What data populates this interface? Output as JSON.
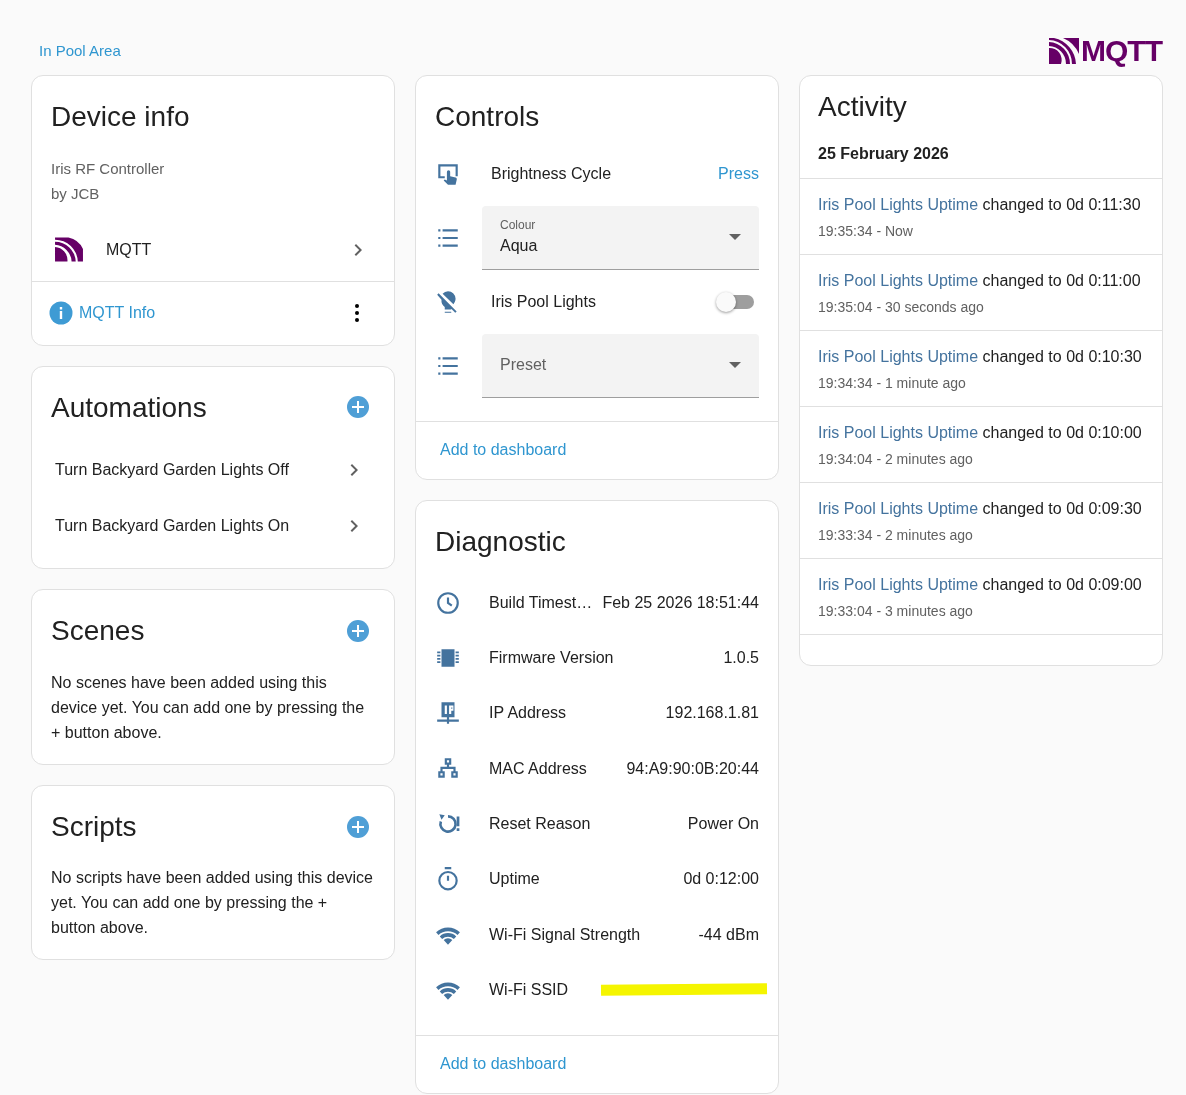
{
  "header": {
    "area_link": "In Pool Area",
    "logo_text": "MQTT"
  },
  "device_info": {
    "title": "Device info",
    "model": "Iris RF Controller",
    "manufacturer": "by JCB",
    "integration": "MQTT",
    "info_link": "MQTT Info"
  },
  "automations": {
    "title": "Automations",
    "items": [
      {
        "label": "Turn Backyard Garden Lights Off"
      },
      {
        "label": "Turn Backyard Garden Lights On"
      }
    ]
  },
  "scenes": {
    "title": "Scenes",
    "empty_text": "No scenes have been added using this device yet. You can add one by pressing the + button above."
  },
  "scripts": {
    "title": "Scripts",
    "empty_text": "No scripts have been added using this device yet. You can add one by pressing the + button above."
  },
  "controls": {
    "title": "Controls",
    "items": [
      {
        "kind": "button",
        "label": "Brightness Cycle",
        "action": "Press"
      },
      {
        "kind": "select",
        "label": "Colour",
        "value": "Aqua"
      },
      {
        "kind": "switch",
        "label": "Iris Pool Lights",
        "on": false
      },
      {
        "kind": "select",
        "label": "Preset"
      }
    ],
    "footer_link": "Add to dashboard"
  },
  "diagnostic": {
    "title": "Diagnostic",
    "items": [
      {
        "label": "Build Timest…",
        "value": "Feb 25 2026 18:51:44"
      },
      {
        "label": "Firmware Version",
        "value": "1.0.5"
      },
      {
        "label": "IP Address",
        "value": "192.168.1.81"
      },
      {
        "label": "MAC Address",
        "value": "94:A9:90:0B:20:44"
      },
      {
        "label": "Reset Reason",
        "value": "Power On"
      },
      {
        "label": "Uptime",
        "value": "0d 0:12:00"
      },
      {
        "label": "Wi-Fi Signal Strength",
        "value": "-44 dBm"
      },
      {
        "label": "Wi-Fi SSID",
        "redacted": true
      }
    ],
    "footer_link": "Add to dashboard"
  },
  "activity": {
    "title": "Activity",
    "date": "25 February 2026",
    "entries": [
      {
        "entity": "Iris Pool Lights Uptime",
        "message": "changed to 0d 0:11:30",
        "time": "19:35:34 - Now"
      },
      {
        "entity": "Iris Pool Lights Uptime",
        "message": "changed to 0d 0:11:00",
        "time": "19:35:04 - 30 seconds ago"
      },
      {
        "entity": "Iris Pool Lights Uptime",
        "message": "changed to 0d 0:10:30",
        "time": "19:34:34 - 1 minute ago"
      },
      {
        "entity": "Iris Pool Lights Uptime",
        "message": "changed to 0d 0:10:00",
        "time": "19:34:04 - 2 minutes ago"
      },
      {
        "entity": "Iris Pool Lights Uptime",
        "message": "changed to 0d 0:09:30",
        "time": "19:33:34 - 2 minutes ago"
      },
      {
        "entity": "Iris Pool Lights Uptime",
        "message": "changed to 0d 0:09:00",
        "time": "19:33:04 - 3 minutes ago"
      }
    ]
  }
}
